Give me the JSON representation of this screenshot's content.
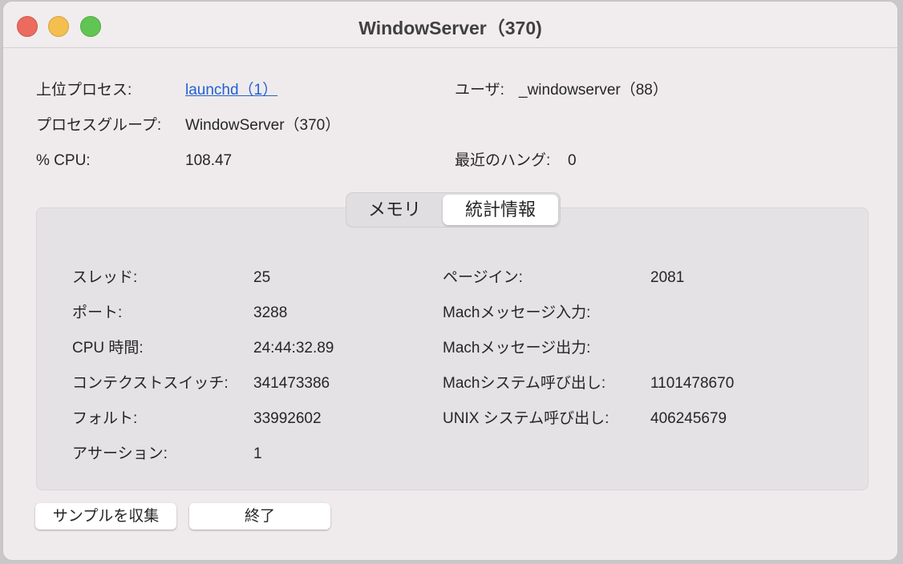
{
  "window": {
    "title": "WindowServer（370)"
  },
  "info": {
    "parent_label": "上位プロセス:",
    "parent_value": "launchd（1）",
    "user_label": "ユーザ:",
    "user_value": "_windowserver（88）",
    "group_label": "プロセスグループ:",
    "group_value": "WindowServer（370）",
    "cpu_label": "% CPU:",
    "cpu_value": "108.47",
    "hangs_label": "最近のハング:",
    "hangs_value": "0"
  },
  "tabs": [
    {
      "label": "メモリ"
    },
    {
      "label": "統計情報"
    }
  ],
  "stats_left": [
    {
      "label": "スレッド:",
      "value": "25"
    },
    {
      "label": "ポート:",
      "value": "3288"
    },
    {
      "label": "CPU 時間:",
      "value": "24:44:32.89"
    },
    {
      "label": "コンテクストスイッチ:",
      "value": "341473386"
    },
    {
      "label": "フォルト:",
      "value": "33992602"
    },
    {
      "label": "アサーション:",
      "value": "1"
    }
  ],
  "stats_right": [
    {
      "label": "ページイン:",
      "value": "2081"
    },
    {
      "label": "Machメッセージ入力:",
      "value": ""
    },
    {
      "label": "Machメッセージ出力:",
      "value": ""
    },
    {
      "label": "Machシステム呼び出し:",
      "value": "1101478670"
    },
    {
      "label": "UNIX システム呼び出し:",
      "value": "406245679"
    }
  ],
  "buttons": {
    "sample": "サンプルを収集",
    "quit": "終了"
  }
}
